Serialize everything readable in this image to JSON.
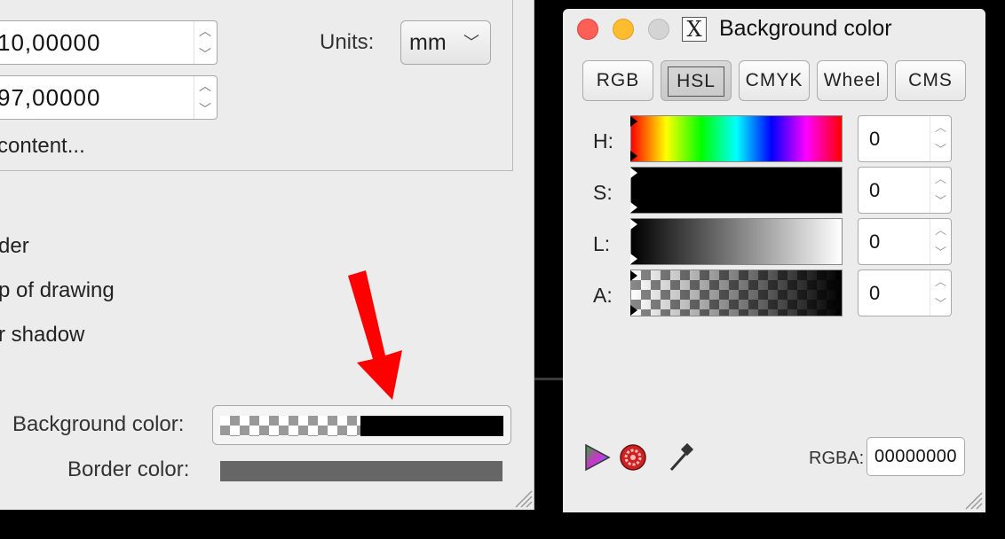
{
  "document_panel": {
    "width_value": "10,00000",
    "height_value": "97,00000",
    "units_label": "Units:",
    "units_value": "mm",
    "resize_to_content": "content...",
    "checkbox_border": "der",
    "checkbox_border_on_top": "p of drawing",
    "checkbox_shadow": "r shadow",
    "background_color_label": "Background color:",
    "border_color_label": "Border color:",
    "border_color_hex": "#666666"
  },
  "color_window": {
    "title": "Background color",
    "modes": [
      "RGB",
      "HSL",
      "CMYK",
      "Wheel",
      "CMS"
    ],
    "active_mode": "HSL",
    "channels": [
      {
        "label": "H:",
        "value": "0"
      },
      {
        "label": "S:",
        "value": "0"
      },
      {
        "label": "L:",
        "value": "0"
      },
      {
        "label": "A:",
        "value": "0"
      }
    ],
    "rgba_label": "RGBA:",
    "rgba_value": "00000000",
    "icons": [
      "gamut-triangle-icon",
      "color-managed-icon",
      "eyedropper-icon"
    ]
  },
  "colors": {
    "close": "#fe5f57",
    "minimize": "#febc2e",
    "maximize": "#d4d4d4",
    "annotation_arrow": "#ff0000"
  }
}
